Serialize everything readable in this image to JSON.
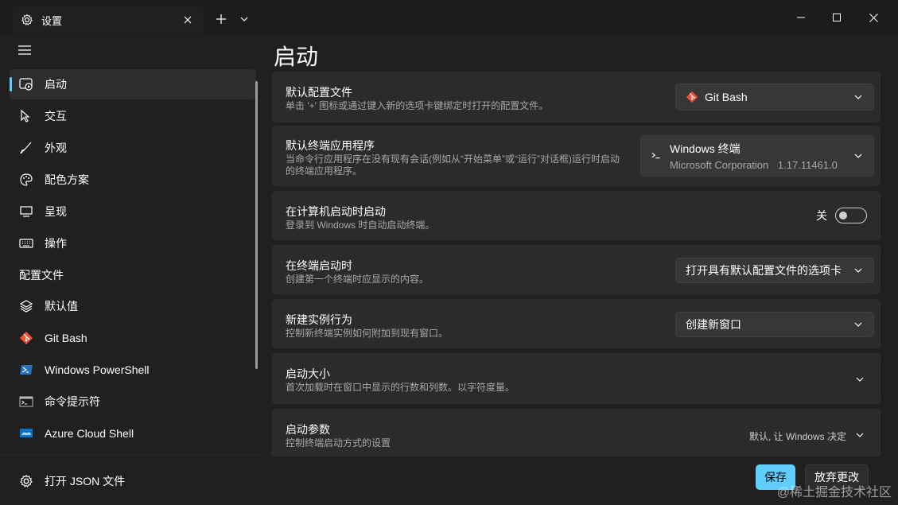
{
  "titlebar": {
    "tab_title": "设置",
    "tab_icon": "gear-icon",
    "window_controls": [
      "minimize-icon",
      "maximize-icon",
      "close-icon"
    ]
  },
  "sidebar": {
    "items": [
      {
        "label": "启动",
        "icon": "launch-icon",
        "active": true
      },
      {
        "label": "交互",
        "icon": "pointer-icon"
      },
      {
        "label": "外观",
        "icon": "brush-icon"
      },
      {
        "label": "配色方案",
        "icon": "palette-icon"
      },
      {
        "label": "呈现",
        "icon": "monitor-icon"
      },
      {
        "label": "操作",
        "icon": "keyboard-icon"
      }
    ],
    "section_header": "配置文件",
    "profiles": [
      {
        "label": "默认值",
        "icon": "layers-icon"
      },
      {
        "label": "Git Bash",
        "icon": "git-icon"
      },
      {
        "label": "Windows PowerShell",
        "icon": "powershell-icon"
      },
      {
        "label": "命令提示符",
        "icon": "cmd-icon"
      },
      {
        "label": "Azure Cloud Shell",
        "icon": "azure-icon"
      }
    ],
    "footer_link": "打开 JSON 文件"
  },
  "main": {
    "title": "启动",
    "settings": {
      "default_profile": {
        "label": "默认配置文件",
        "desc": "单击 '+' 图标或通过键入新的选项卡键绑定时打开的配置文件。",
        "value": "Git Bash"
      },
      "default_terminal": {
        "label": "默认终端应用程序",
        "desc_line1": "当命令行应用程序在没有现有会话(例如从“开始菜单”或“运行”对话框)运行时启动",
        "desc_line2": "的终端应用程序。",
        "value_name": "Windows 终端",
        "value_publisher": "Microsoft Corporation",
        "value_version": "1.17.11461.0"
      },
      "launch_on_startup": {
        "label": "在计算机启动时启动",
        "desc": "登录到 Windows 时自动启动终端。",
        "toggle_text": "关",
        "toggle_on": false
      },
      "on_terminal_start": {
        "label": "在终端启动时",
        "desc": "创建第一个终端时应显示的内容。",
        "value": "打开具有默认配置文件的选项卡"
      },
      "new_instance": {
        "label": "新建实例行为",
        "desc": "控制新终端实例如何附加到现有窗口。",
        "value": "创建新窗口"
      },
      "launch_size": {
        "label": "启动大小",
        "desc": "首次加载时在窗口中显示的行数和列数。以字符度量。"
      },
      "launch_params": {
        "label": "启动参数",
        "desc": "控制终端启动方式的设置",
        "value": "默认, 让 Windows 决定"
      }
    }
  },
  "footer": {
    "save": "保存",
    "discard": "放弃更改"
  },
  "watermark": "@稀土掘金技术社区",
  "colors": {
    "accent": "#60cdff",
    "background": "#202020",
    "card": "#2b2b2b"
  }
}
